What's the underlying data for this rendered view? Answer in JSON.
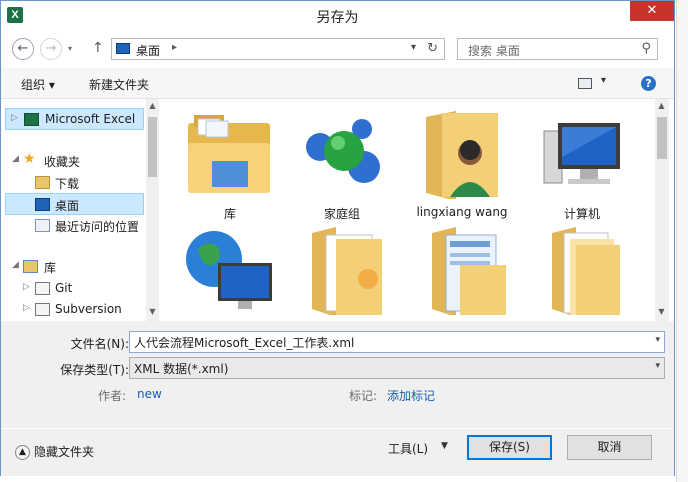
{
  "window": {
    "title": "另存为",
    "app_icon": "X",
    "close_glyph": "✕"
  },
  "address": {
    "location": "桌面",
    "chevron": "▸",
    "search_placeholder": "搜索 桌面"
  },
  "toolbar": {
    "organize": "组织 ▾",
    "new_folder": "新建文件夹"
  },
  "sidebar": {
    "items": [
      {
        "label": "Microsoft Excel",
        "icon": "excel-icon"
      },
      {
        "label": "收藏夹",
        "icon": "star-icon"
      },
      {
        "label": "下载",
        "icon": "download-folder-icon"
      },
      {
        "label": "桌面",
        "icon": "desktop-icon"
      },
      {
        "label": "最近访问的位置",
        "icon": "recent-places-icon"
      },
      {
        "label": "库",
        "icon": "libraries-icon"
      },
      {
        "label": "Git",
        "icon": "library-icon"
      },
      {
        "label": "Subversion",
        "icon": "library-icon"
      }
    ]
  },
  "files": {
    "items": [
      {
        "label": "库",
        "icon": "libraries-folder-icon"
      },
      {
        "label": "家庭组",
        "icon": "homegroup-icon"
      },
      {
        "label": "lingxiang wang",
        "icon": "user-folder-icon"
      },
      {
        "label": "计算机",
        "icon": "computer-icon"
      },
      {
        "label": "",
        "icon": "network-icon"
      },
      {
        "label": "",
        "icon": "folder-icon"
      },
      {
        "label": "",
        "icon": "folder-icon"
      },
      {
        "label": "",
        "icon": "folder-icon"
      }
    ]
  },
  "form": {
    "filename_label": "文件名(N):",
    "filename_value": "人代会流程Microsoft_Excel_工作表.xml",
    "filetype_label": "保存类型(T):",
    "filetype_value": "XML 数据(*.xml)",
    "author_label": "作者:",
    "author_value": "new",
    "tags_label": "标记:",
    "tags_value": "添加标记"
  },
  "footer": {
    "hide_folders": "隐藏文件夹",
    "tools": "工具(L)",
    "save": "保存(S)",
    "cancel": "取消"
  },
  "colors": {
    "accent": "#0078d7",
    "selection": "#cce8ff",
    "close": "#c7342b",
    "link": "#1a5fb4"
  }
}
